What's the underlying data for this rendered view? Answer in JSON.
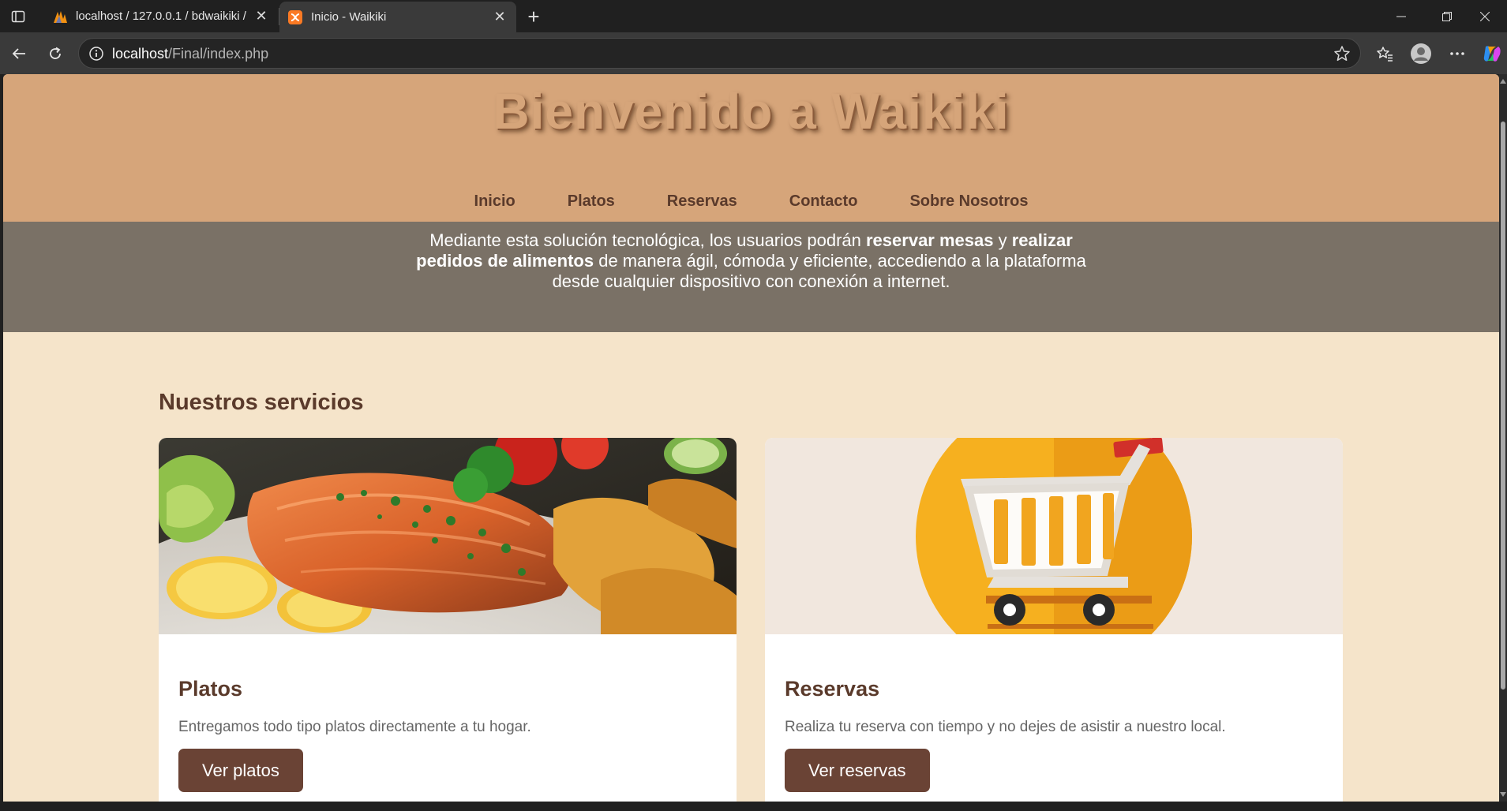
{
  "browser": {
    "tabs": [
      {
        "title": "localhost / 127.0.0.1 / bdwaikiki /",
        "active": false,
        "icon": "phpmyadmin-icon"
      },
      {
        "title": "Inicio - Waikiki",
        "active": true,
        "icon": "xampp-icon"
      }
    ],
    "address": {
      "host": "localhost",
      "path": "/Final/index.php"
    }
  },
  "site": {
    "title": "Bienvenido a Waikiki",
    "nav": [
      "Inicio",
      "Platos",
      "Reservas",
      "Contacto",
      "Sobre Nosotros"
    ],
    "hero": {
      "part1": "Mediante esta solución tecnológica, los usuarios podrán ",
      "bold1": "reservar mesas",
      "part2": " y ",
      "bold2": "realizar pedidos de alimentos",
      "part3": " de manera ágil, cómoda y eficiente, accediendo a la plataforma desde cualquier dispositivo con conexión a internet."
    },
    "services_title": "Nuestros servicios",
    "cards": [
      {
        "title": "Platos",
        "description": "Entregamos todo tipo platos directamente a tu hogar.",
        "button": "Ver platos"
      },
      {
        "title": "Reservas",
        "description": "Realiza tu reserva con tiempo y no dejes de asistir a nuestro local.",
        "button": "Ver reservas"
      }
    ]
  },
  "colors": {
    "header_bg": "#d6a57a",
    "hero_bg": "#7a7166",
    "page_bg": "#f5e4ca",
    "brand_brown": "#5a3a2b",
    "button_bg": "#6a4335"
  }
}
